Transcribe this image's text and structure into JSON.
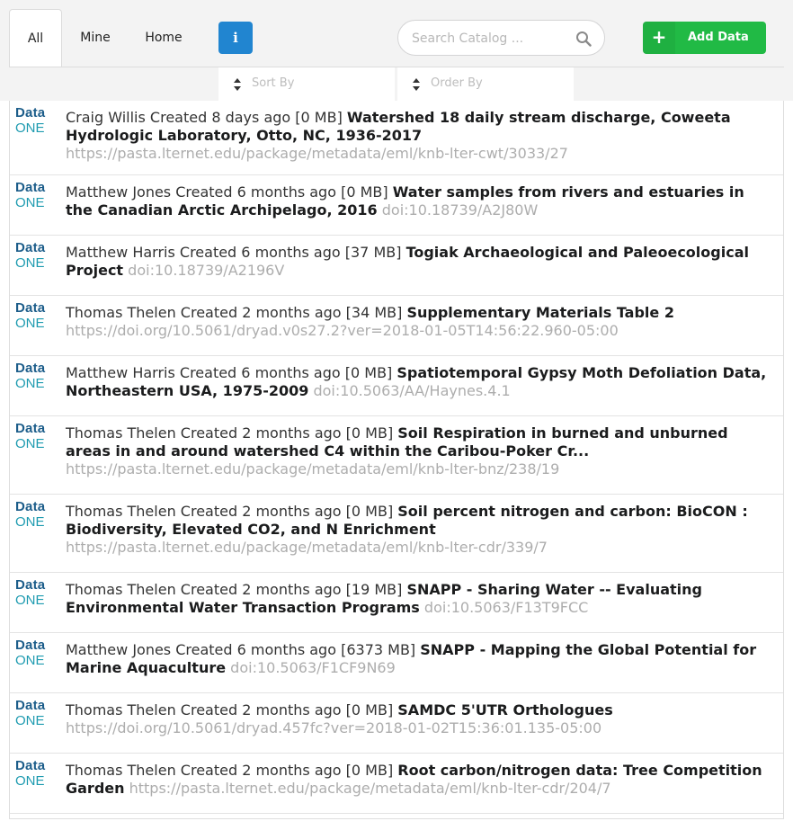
{
  "tabs": [
    {
      "label": "All",
      "active": true
    },
    {
      "label": "Mine",
      "active": false
    },
    {
      "label": "Home",
      "active": false
    }
  ],
  "info_button": {
    "label": "i",
    "icon": "info-icon"
  },
  "search": {
    "placeholder": "Search Catalog ...",
    "value": "",
    "icon": "search-icon"
  },
  "add_button": {
    "icon_label": "+",
    "label": "Add Data",
    "color": "#21ba45"
  },
  "sort_dropdown": {
    "label": "Sort By"
  },
  "order_dropdown": {
    "label": "Order By"
  },
  "logo": {
    "line1": "Data",
    "line2": "ONE"
  },
  "colors": {
    "accent": "#2185d0",
    "add": "#21ba45",
    "logo_dark": "#1c5d8a",
    "logo_light": "#1e9bb0"
  },
  "items": [
    {
      "meta": "Craig Willis Created 8 days ago [0 MB]",
      "title": "Watershed 18 daily stream discharge, Coweeta Hydrologic Laboratory, Otto, NC, 1936-2017",
      "identifier": "https://pasta.lternet.edu/package/metadata/eml/knb-lter-cwt/3033/27"
    },
    {
      "meta": "Matthew Jones Created 6 months ago [0 MB]",
      "title": "Water samples from rivers and estuaries in the Canadian Arctic Archipelago, 2016",
      "identifier": "doi:10.18739/A2J80W"
    },
    {
      "meta": "Matthew Harris Created 6 months ago [37 MB]",
      "title": "Togiak Archaeological and Paleoecological Project",
      "identifier": "doi:10.18739/A2196V"
    },
    {
      "meta": "Thomas Thelen Created 2 months ago [34 MB]",
      "title": "Supplementary Materials Table 2",
      "identifier": "https://doi.org/10.5061/dryad.v0s27.2?ver=2018-01-05T14:56:22.960-05:00"
    },
    {
      "meta": "Matthew Harris Created 6 months ago [0 MB]",
      "title": "Spatiotemporal Gypsy Moth Defoliation Data, Northeastern USA, 1975-2009",
      "identifier": "doi:10.5063/AA/Haynes.4.1"
    },
    {
      "meta": "Thomas Thelen Created 2 months ago [0 MB]",
      "title": "Soil Respiration in burned and unburned areas in and around watershed C4 within the Caribou-Poker Cr...",
      "identifier": "https://pasta.lternet.edu/package/metadata/eml/knb-lter-bnz/238/19"
    },
    {
      "meta": "Thomas Thelen Created 2 months ago [0 MB]",
      "title": "Soil percent nitrogen and carbon: BioCON : Biodiversity, Elevated CO2, and N Enrichment",
      "identifier": "https://pasta.lternet.edu/package/metadata/eml/knb-lter-cdr/339/7"
    },
    {
      "meta": "Thomas Thelen Created 2 months ago [19 MB]",
      "title": "SNAPP - Sharing Water -- Evaluating Environmental Water Transaction Programs",
      "identifier": "doi:10.5063/F13T9FCC"
    },
    {
      "meta": "Matthew Jones Created 6 months ago [6373 MB]",
      "title": "SNAPP - Mapping the Global Potential for Marine Aquaculture",
      "identifier": "doi:10.5063/F1CF9N69"
    },
    {
      "meta": "Thomas Thelen Created 2 months ago [0 MB]",
      "title": "SAMDC 5'UTR Orthologues",
      "identifier": "https://doi.org/10.5061/dryad.457fc?ver=2018-01-02T15:36:01.135-05:00"
    },
    {
      "meta": "Thomas Thelen Created 2 months ago [0 MB]",
      "title": "Root carbon/nitrogen data: Tree Competition Garden",
      "identifier": "https://pasta.lternet.edu/package/metadata/eml/knb-lter-cdr/204/7"
    }
  ]
}
